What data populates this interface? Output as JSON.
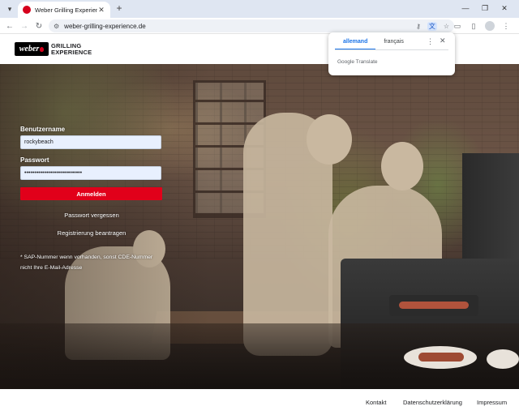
{
  "browser": {
    "tab_title": "Weber Grilling Experience",
    "url": "weber-grilling-experience.de"
  },
  "site": {
    "logo_mark": "weber",
    "logo_words_1": "GRILLING",
    "logo_words_2": "EXPERIENCE"
  },
  "login": {
    "username_label": "Benutzername",
    "username_value": "rockybeach",
    "password_label": "Passwort",
    "password_value": "•••••••••••••••••••••••••••••",
    "submit_label": "Anmelden",
    "forgot_link": "Passwort vergessen",
    "register_link": "Registrierung beantragen",
    "note": "* SAP-Nummer wenn vorhanden, sonst CDE-Nummer nicht Ihre E-Mail-Adresse"
  },
  "footer": {
    "contact": "Kontakt",
    "privacy": "Datenschutzerklärung",
    "imprint": "Impressum"
  },
  "translate": {
    "source_lang": "allemand",
    "target_lang": "français",
    "brand_google": "Google",
    "brand_translate": "Translate"
  },
  "colors": {
    "brand_red": "#e1001a",
    "link_blue": "#1a73e8"
  }
}
